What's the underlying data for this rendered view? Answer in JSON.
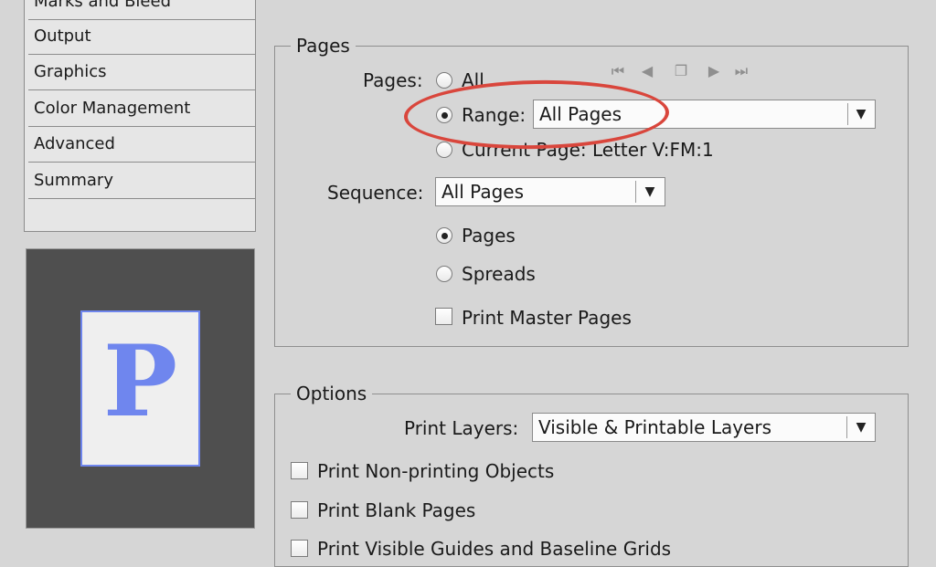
{
  "sidebar": {
    "items": [
      {
        "label": "Marks and Bleed"
      },
      {
        "label": "Output"
      },
      {
        "label": "Graphics"
      },
      {
        "label": "Color Management"
      },
      {
        "label": "Advanced"
      },
      {
        "label": "Summary"
      }
    ]
  },
  "preview": {
    "letter": "P"
  },
  "pages_group": {
    "title": "Pages",
    "pages_label": "Pages:",
    "option_all": "All",
    "option_range": "Range:",
    "range_value": "All Pages",
    "option_current": "Current Page: Letter V:FM:1",
    "sequence_label": "Sequence:",
    "sequence_value": "All Pages",
    "option_pages": "Pages",
    "option_spreads": "Spreads",
    "print_master_pages": "Print Master Pages"
  },
  "options_group": {
    "title": "Options",
    "print_layers_label": "Print Layers:",
    "print_layers_value": "Visible & Printable Layers",
    "print_nonprinting": "Print Non-printing Objects",
    "print_blank_pages": "Print Blank Pages",
    "print_guides": "Print Visible Guides and Baseline Grids"
  },
  "colors": {
    "highlight": "#d9463c",
    "preview_accent": "#6f86ee"
  }
}
